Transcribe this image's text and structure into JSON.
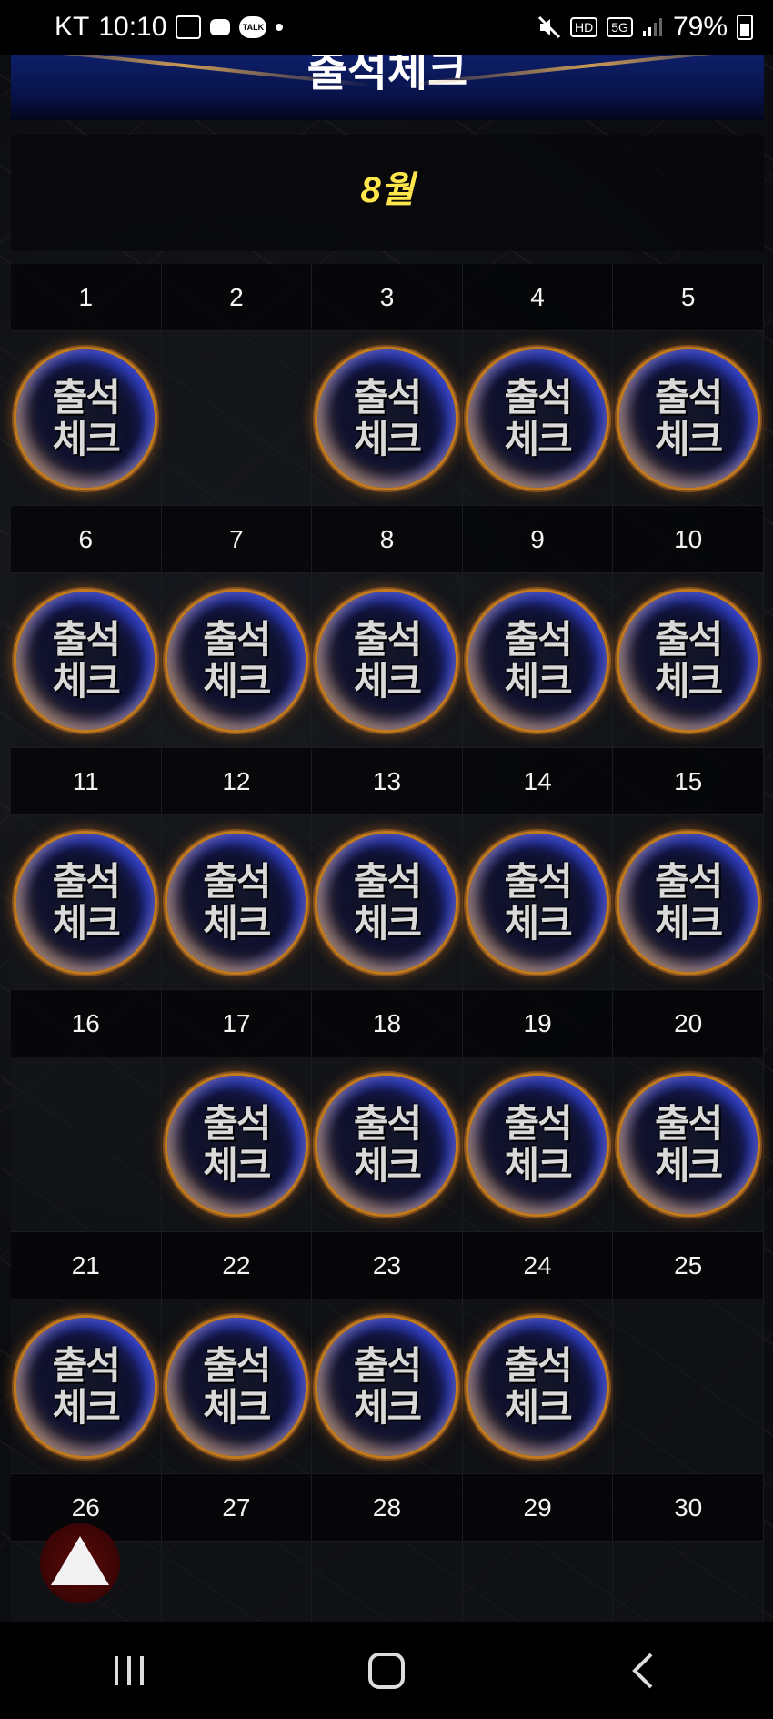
{
  "status_bar": {
    "carrier": "KT",
    "time": "10:10",
    "network": "5G",
    "hd_label": "HD",
    "talk_label": "TALK",
    "battery": "79%"
  },
  "banner": {
    "title": "출석체크"
  },
  "calendar": {
    "month": "8월",
    "stamp_label_line1": "출석",
    "stamp_label_line2": "체크",
    "weeks": [
      {
        "days": [
          "1",
          "2",
          "3",
          "4",
          "5"
        ],
        "stamped": [
          true,
          false,
          true,
          true,
          true
        ]
      },
      {
        "days": [
          "6",
          "7",
          "8",
          "9",
          "10"
        ],
        "stamped": [
          true,
          true,
          true,
          true,
          true
        ]
      },
      {
        "days": [
          "11",
          "12",
          "13",
          "14",
          "15"
        ],
        "stamped": [
          true,
          true,
          true,
          true,
          true
        ]
      },
      {
        "days": [
          "16",
          "17",
          "18",
          "19",
          "20"
        ],
        "stamped": [
          false,
          true,
          true,
          true,
          true
        ]
      },
      {
        "days": [
          "21",
          "22",
          "23",
          "24",
          "25"
        ],
        "stamped": [
          true,
          true,
          true,
          true,
          false
        ]
      },
      {
        "days": [
          "26",
          "27",
          "28",
          "29",
          "30"
        ],
        "stamped": [
          false,
          false,
          false,
          false,
          false
        ]
      }
    ]
  },
  "icons": {
    "scroll_top": "triangle-up-icon",
    "nav_recents": "recents-icon",
    "nav_home": "home-icon",
    "nav_back": "back-icon"
  }
}
